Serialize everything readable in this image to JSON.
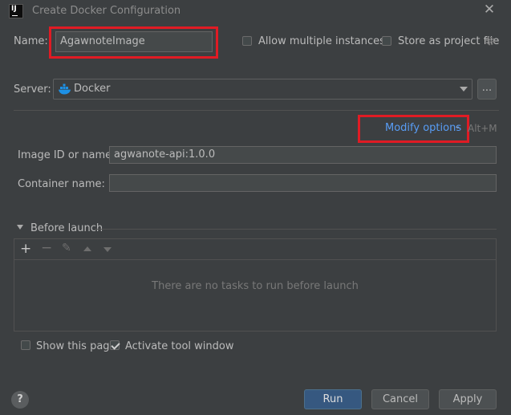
{
  "window": {
    "title": "Create Docker Configuration",
    "logo_text": "IJ"
  },
  "name_row": {
    "label": "Name:",
    "value": "AgawnoteImage",
    "allow_multiple_label": "Allow multiple instances",
    "allow_multiple_checked": false,
    "store_project_label": "Store as project file",
    "store_project_checked": false
  },
  "server_row": {
    "label": "Server:",
    "value": "Docker",
    "browse_label": "..."
  },
  "modify": {
    "label": "Modify options",
    "shortcut": "Alt+M"
  },
  "image_row": {
    "label": "Image ID or name:",
    "value": "agwanote-api:1.0.0"
  },
  "container_row": {
    "label": "Container name:",
    "value": ""
  },
  "before_launch": {
    "title": "Before launch",
    "empty_text": "There are no tasks to run before launch"
  },
  "footer": {
    "show_page_label": "Show this page",
    "show_page_checked": false,
    "activate_tool_label": "Activate tool window",
    "activate_tool_checked": true,
    "help_label": "?",
    "run_label": "Run",
    "cancel_label": "Cancel",
    "apply_label": "Apply"
  },
  "colors": {
    "background": "#3c3f41",
    "highlight": "#e01b24",
    "link": "#589df6",
    "primary_button": "#365880",
    "docker_icon": "#1d91e6"
  }
}
